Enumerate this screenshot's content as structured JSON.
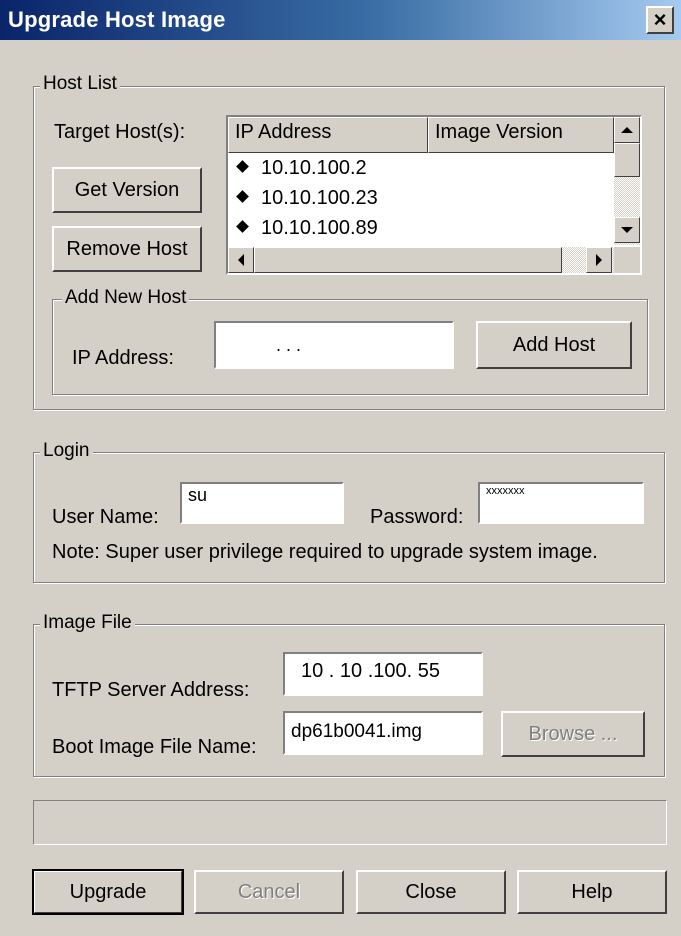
{
  "window": {
    "title": "Upgrade Host Image",
    "close_glyph": "×"
  },
  "host_list": {
    "legend": "Host List",
    "target_label": "Target Host(s):",
    "get_version_label": "Get Version",
    "remove_host_label": "Remove Host",
    "columns": [
      "IP Address",
      "Image Version"
    ],
    "hosts": [
      {
        "ip": "10.10.100.2",
        "version": ""
      },
      {
        "ip": "10.10.100.23",
        "version": ""
      },
      {
        "ip": "10.10.100.89",
        "version": ""
      }
    ],
    "add_new_host": {
      "legend": "Add New Host",
      "ip_label": "IP Address:",
      "ip_value": ".       .       .",
      "add_host_label": "Add Host"
    }
  },
  "login": {
    "legend": "Login",
    "user_label": "User Name:",
    "user_value": "su",
    "password_label": "Password:",
    "password_value": "xxxxxxx",
    "note": "Note: Super user privilege required to upgrade system image."
  },
  "image_file": {
    "legend": "Image File",
    "tftp_label": "TFTP Server Address:",
    "tftp_value": "10 . 10 .100. 55",
    "boot_label": "Boot Image File Name:",
    "boot_value": "dp61b0041.img",
    "browse_label": "Browse ..."
  },
  "status_text": "",
  "buttons": {
    "upgrade": "Upgrade",
    "cancel": "Cancel",
    "close": "Close",
    "help": "Help"
  },
  "colors": {
    "face": "#d4d0c8",
    "title_start": "#0a246a",
    "title_end": "#a6caf0"
  },
  "icons": [
    "close-icon",
    "scroll-up-icon",
    "scroll-down-icon",
    "scroll-left-icon",
    "scroll-right-icon",
    "bullet-icon"
  ]
}
